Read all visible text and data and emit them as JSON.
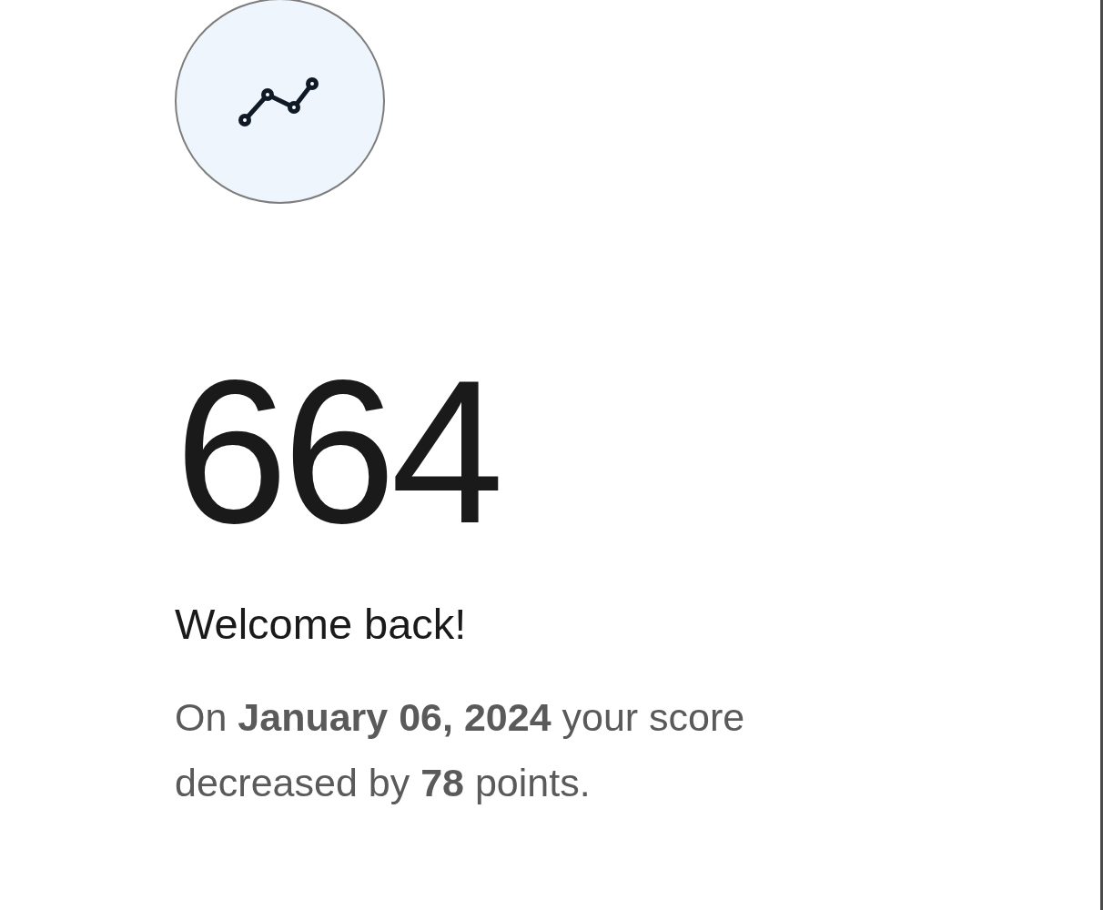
{
  "score": "664",
  "greeting": "Welcome back!",
  "message": "On **January 06, 2024** your score decreased by **78** points."
}
